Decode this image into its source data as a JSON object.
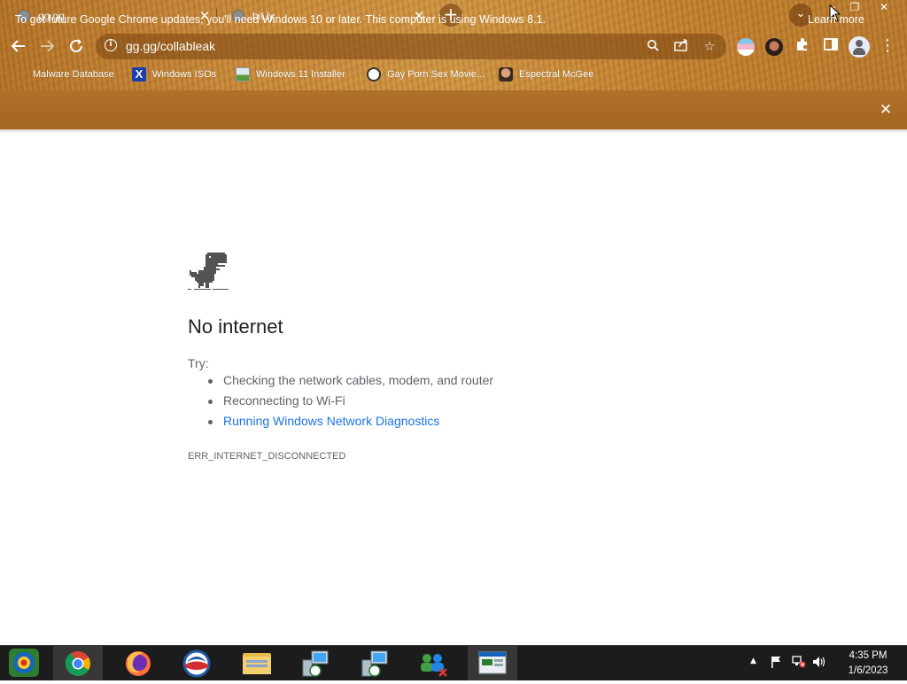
{
  "tabs": [
    {
      "title": "gg.gg",
      "active": true
    },
    {
      "title": "bit.ly",
      "active": false
    }
  ],
  "window_controls": {
    "minimize": "–",
    "maximize": "❐",
    "close": "✕"
  },
  "omnibox": {
    "url": "gg.gg/collableak"
  },
  "bookmarks": [
    {
      "label": "Malware Database",
      "icon": "blank-icon"
    },
    {
      "label": "Windows ISOs",
      "icon": "x-logo-icon"
    },
    {
      "label": "Windows 11 Installer",
      "icon": "image-icon"
    },
    {
      "label": "Gay Porn Sex Movie...",
      "icon": "globe-icon"
    },
    {
      "label": "Espectral McGee",
      "icon": "avatar-icon"
    }
  ],
  "infobar": {
    "message": "To get future Google Chrome updates, you'll need Windows 10 or later. This computer is using Windows 8.1.",
    "learn_more": "Learn more"
  },
  "error_page": {
    "heading": "No internet",
    "try_label": "Try:",
    "suggestions": [
      "Checking the network cables, modem, and router",
      "Reconnecting to Wi-Fi",
      "Running Windows Network Diagnostics"
    ],
    "error_code": "ERR_INTERNET_DISCONNECTED"
  },
  "taskbar": {
    "apps": [
      "start-orb",
      "chrome",
      "firefox",
      "obama-logo",
      "file-explorer",
      "network-app-1",
      "network-app-2",
      "network-people",
      "desktop-app"
    ],
    "clock": {
      "time": "4:35 PM",
      "date": "1/6/2023"
    }
  },
  "colors": {
    "frame": "#c38131",
    "infobar": "#a86a20",
    "link": "#1a73e8",
    "text_secondary": "#5f6368",
    "heading": "#202124",
    "taskbar": "#1c1c1c"
  }
}
